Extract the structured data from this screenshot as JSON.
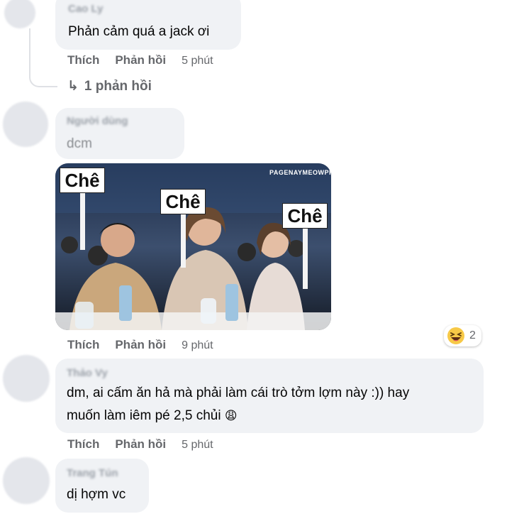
{
  "colors": {
    "bubble": "#f0f2f5",
    "action_text": "#65676b",
    "text": "#050505"
  },
  "comments": [
    {
      "author": "Cao Ly",
      "text": "Phản cảm quá a jack ơi",
      "actions": {
        "like": "Thích",
        "reply": "Phản hồi",
        "time": "5 phút"
      },
      "replies_link": "1 phản hồi"
    },
    {
      "author": "Người dùng",
      "text": "dcm",
      "meme": {
        "signs": [
          "Chê",
          "Chê",
          "Chê"
        ],
        "watermark": "PAGENAYMEOWPHET"
      },
      "reactions": {
        "icon": "laughing-emoji",
        "count": "2"
      },
      "actions": {
        "like": "Thích",
        "reply": "Phản hồi",
        "time": "9 phút"
      }
    },
    {
      "author": "Thảo Vy",
      "text_line1": "dm, ai cấm ăn hả mà phải làm cái trò tởm lợm này :)) hay",
      "text_line2": "muốn làm iêm pé 2,5 chủi",
      "emoji": "😩",
      "actions": {
        "like": "Thích",
        "reply": "Phản hồi",
        "time": "5 phút"
      }
    },
    {
      "author": "Trang Tún",
      "text": "dị hợm vc"
    }
  ]
}
